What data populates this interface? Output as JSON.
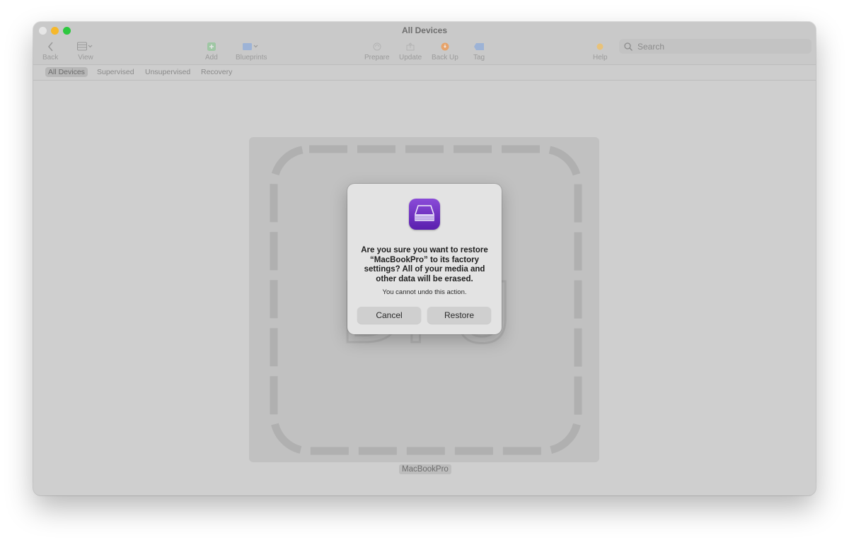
{
  "window": {
    "title": "All Devices"
  },
  "toolbar": {
    "back_label": "Back",
    "view_label": "View",
    "add_label": "Add",
    "blueprints_label": "Blueprints",
    "prepare_label": "Prepare",
    "update_label": "Update",
    "backup_label": "Back Up",
    "tag_label": "Tag",
    "help_label": "Help"
  },
  "search": {
    "placeholder": "Search"
  },
  "filters": {
    "all": "All Devices",
    "supervised": "Supervised",
    "unsupervised": "Unsupervised",
    "recovery": "Recovery",
    "selected": "All Devices"
  },
  "device": {
    "name": "MacBookPro",
    "placeholder_text": "DFU"
  },
  "dialog": {
    "icon": "apple-configurator-icon",
    "title": "Are you sure you want to restore “MacBookPro” to its factory settings? All of your media and other data will be erased.",
    "message": "You cannot undo this action.",
    "cancel_label": "Cancel",
    "restore_label": "Restore"
  },
  "colors": {
    "close": "#e6e6e6",
    "minimize": "#f6b82b",
    "maximize": "#2dc83f",
    "add_icon": "#2fbf4a",
    "blueprints_icon": "#3a7df0",
    "backup_icon": "#f08a2a",
    "tag_icon": "#3a7df0",
    "help_icon": "#f0a030",
    "app_icon": "#6a2ec4"
  }
}
